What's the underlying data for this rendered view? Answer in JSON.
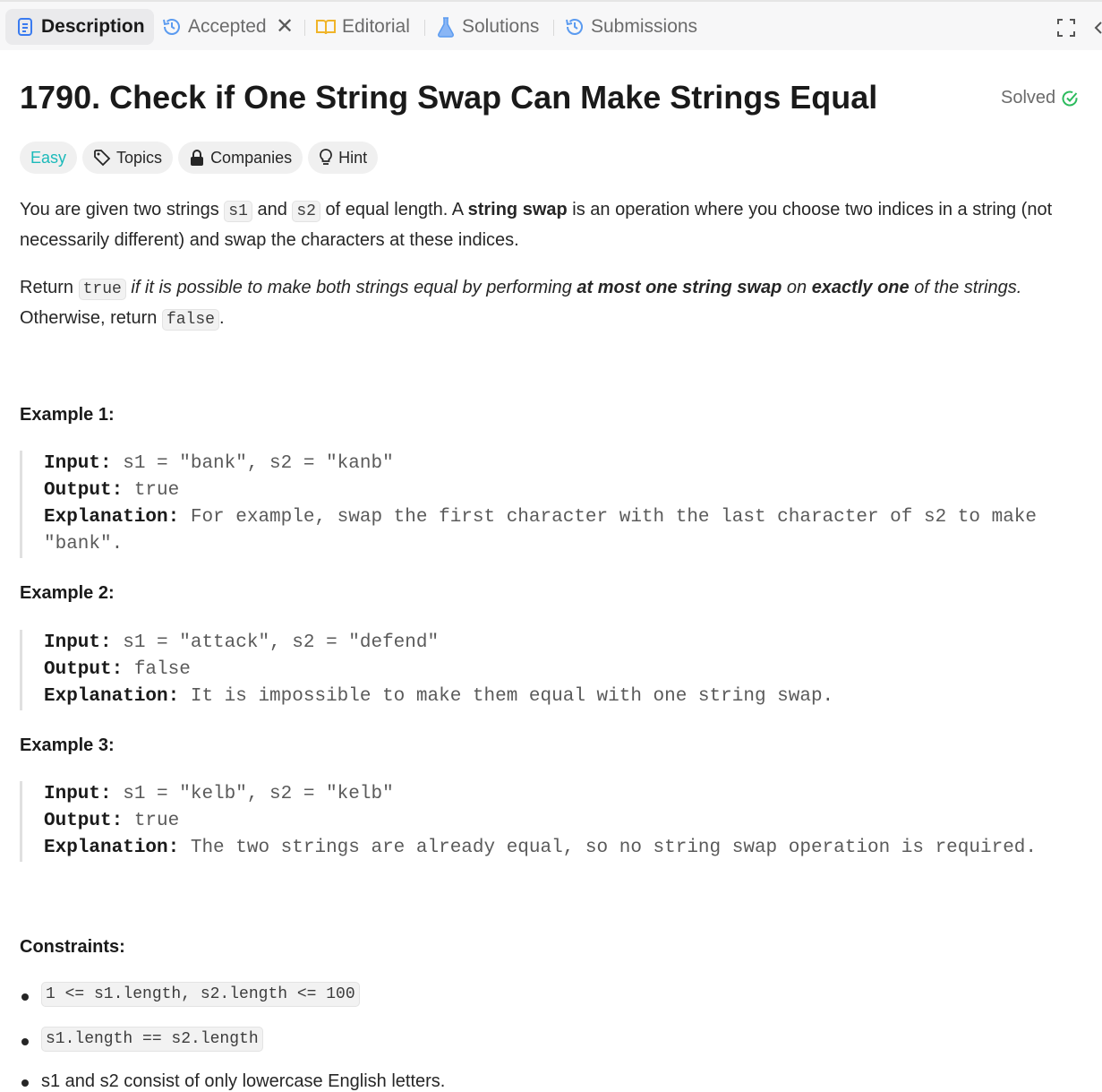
{
  "tabs": [
    {
      "label": "Description",
      "icon": "description-icon"
    },
    {
      "label": "Accepted",
      "icon": "history-icon"
    },
    {
      "label": "Editorial",
      "icon": "book-icon"
    },
    {
      "label": "Solutions",
      "icon": "flask-icon"
    },
    {
      "label": "Submissions",
      "icon": "history-icon"
    }
  ],
  "problem": {
    "title": "1790. Check if One String Swap Can Make Strings Equal",
    "status": "Solved",
    "difficulty": "Easy",
    "chips": {
      "topics": "Topics",
      "companies": "Companies",
      "hint": "Hint"
    }
  },
  "description": {
    "p1_a": "You are given two strings ",
    "p1_code1": "s1",
    "p1_b": " and ",
    "p1_code2": "s2",
    "p1_c": " of equal length. A ",
    "p1_bold": "string swap",
    "p1_d": " is an operation where you choose two indices in a string (not necessarily different) and swap the characters at these indices.",
    "p2_a": "Return ",
    "p2_code1": "true",
    "p2_b": " if it is possible to make both strings equal by performing ",
    "p2_bold1": "at most one string swap",
    "p2_c": " on ",
    "p2_bold2": "exactly one",
    "p2_d": " of the strings.",
    "p2_e": " Otherwise, return ",
    "p2_code2": "false",
    "p2_f": "."
  },
  "examples": [
    {
      "heading": "Example 1:",
      "input": "s1 = \"bank\", s2 = \"kanb\"",
      "output": "true",
      "explanation": "For example, swap the first character with the last character of s2 to make \"bank\"."
    },
    {
      "heading": "Example 2:",
      "input": "s1 = \"attack\", s2 = \"defend\"",
      "output": "false",
      "explanation": "It is impossible to make them equal with one string swap."
    },
    {
      "heading": "Example 3:",
      "input": "s1 = \"kelb\", s2 = \"kelb\"",
      "output": "true",
      "explanation": "The two strings are already equal, so no string swap operation is required."
    }
  ],
  "labels": {
    "input": "Input:",
    "output": "Output:",
    "explanation": "Explanation:"
  },
  "constraints": {
    "heading": "Constraints:",
    "items": [
      "1 <= s1.length, s2.length <= 100",
      "s1.length == s2.length",
      "s1 and s2 consist of only lowercase English letters."
    ]
  },
  "colors": {
    "easy": "#1cbaba",
    "solved": "#2cbb5d",
    "accent": "#3a7bf0"
  }
}
